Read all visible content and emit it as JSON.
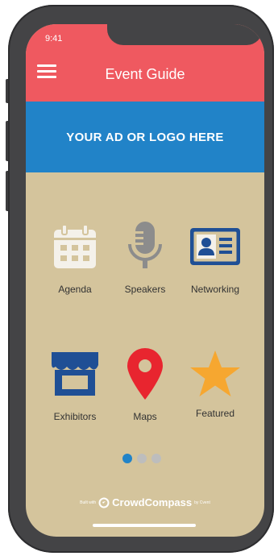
{
  "status": {
    "time": "9:41"
  },
  "header": {
    "title": "Event Guide"
  },
  "ad": {
    "text": "YOUR AD OR LOGO HERE"
  },
  "tiles": [
    {
      "label": "Agenda",
      "icon": "calendar-icon"
    },
    {
      "label": "Speakers",
      "icon": "microphone-icon"
    },
    {
      "label": "Networking",
      "icon": "contact-card-icon"
    },
    {
      "label": "Exhibitors",
      "icon": "storefront-icon"
    },
    {
      "label": "Maps",
      "icon": "map-pin-icon"
    },
    {
      "label": "Featured",
      "icon": "star-icon"
    }
  ],
  "pager": {
    "pages": 3,
    "current": 1
  },
  "footer": {
    "prefix": "Built with",
    "brand": "CrowdCompass",
    "suffix": "by Cvent"
  },
  "colors": {
    "header": "#ef5960",
    "banner": "#2183c8",
    "background": "#d4c49c",
    "tile_icon_light": "#f4f1ea",
    "tile_icon_gray": "#8c8c8c",
    "tile_icon_navy": "#1f4f95",
    "pin_red": "#e8252f",
    "star_orange": "#f6a730"
  }
}
